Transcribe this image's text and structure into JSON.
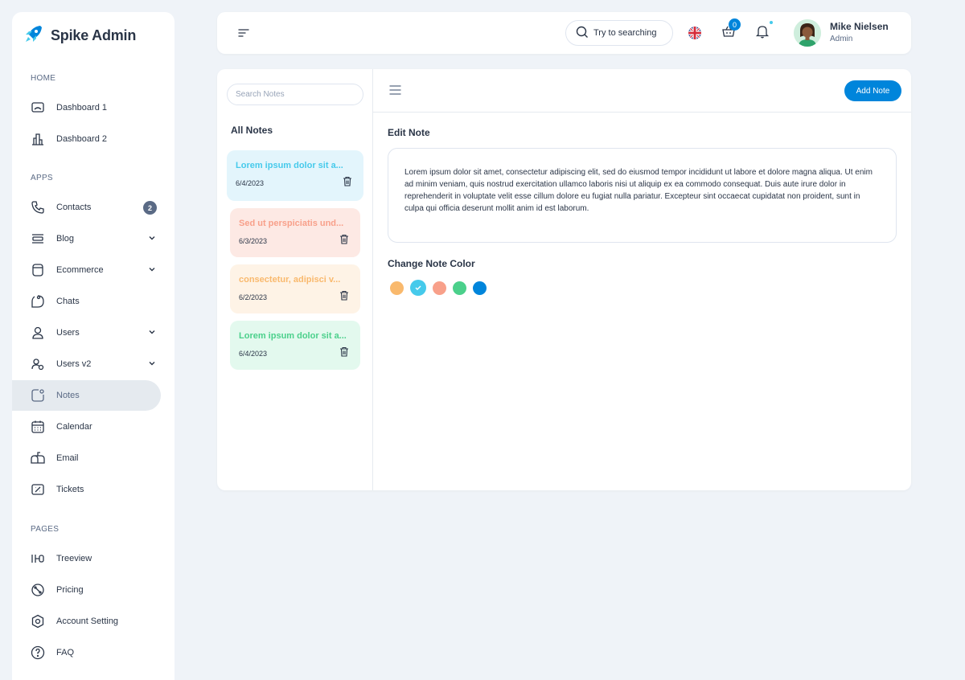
{
  "app": {
    "title": "Spike Admin"
  },
  "sidebar": {
    "sections": [
      {
        "label": "HOME"
      },
      {
        "label": "APPS"
      },
      {
        "label": "PAGES"
      }
    ],
    "items": [
      {
        "label": "Dashboard 1",
        "icon": "monitor-icon"
      },
      {
        "label": "Dashboard 2",
        "icon": "buildings-icon"
      },
      {
        "label": "Contacts",
        "icon": "phone-icon",
        "badge": "2"
      },
      {
        "label": "Blog",
        "icon": "blog-icon"
      },
      {
        "label": "Ecommerce",
        "icon": "basket-icon"
      },
      {
        "label": "Chats",
        "icon": "chat-icon"
      },
      {
        "label": "Users",
        "icon": "user-icon"
      },
      {
        "label": "Users v2",
        "icon": "users-icon"
      },
      {
        "label": "Notes",
        "icon": "note-icon",
        "active": true
      },
      {
        "label": "Calendar",
        "icon": "calendar-icon"
      },
      {
        "label": "Email",
        "icon": "mailbox-icon"
      },
      {
        "label": "Tickets",
        "icon": "ticket-icon"
      },
      {
        "label": "Treeview",
        "icon": "treeview-icon"
      },
      {
        "label": "Pricing",
        "icon": "pricing-icon"
      },
      {
        "label": "Account Setting",
        "icon": "settings-icon"
      },
      {
        "label": "FAQ",
        "icon": "question-icon"
      }
    ]
  },
  "topbar": {
    "search_label": "Try to searching",
    "cart_count": "0",
    "user": {
      "name": "Mike Nielsen",
      "role": "Admin"
    }
  },
  "notes": {
    "search_placeholder": "Search Notes",
    "list_title": "All Notes",
    "items": [
      {
        "title": "Lorem ipsum dolor sit a...",
        "date": "6/4/2023",
        "bg": "#e3f5fc",
        "color": "#46caeb"
      },
      {
        "title": "Sed ut perspiciatis und...",
        "date": "6/3/2023",
        "bg": "#fde9e4",
        "color": "#f8a08a"
      },
      {
        "title": "consectetur, adipisci v...",
        "date": "6/2/2023",
        "bg": "#fef3e6",
        "color": "#f9b96d"
      },
      {
        "title": "Lorem ipsum dolor sit a...",
        "date": "6/4/2023",
        "bg": "#e3f9ee",
        "color": "#4bd08b"
      }
    ],
    "add_button": "Add Note",
    "edit_title": "Edit Note",
    "edit_text": "Lorem ipsum dolor sit amet, consectetur adipiscing elit, sed do eiusmod tempor incididunt ut labore et dolore magna aliqua. Ut enim ad minim veniam, quis nostrud exercitation ullamco laboris nisi ut aliquip ex ea commodo consequat. Duis aute irure dolor in reprehenderit in voluptate velit esse cillum dolore eu fugiat nulla pariatur. Excepteur sint occaecat cupidatat non proident, sunt in culpa qui officia deserunt mollit anim id est laborum.",
    "color_title": "Change Note Color",
    "colors": [
      "#f9b96d",
      "#46caeb",
      "#f8a08a",
      "#4bd08b",
      "#0085db"
    ],
    "selected_color": "#46caeb"
  }
}
